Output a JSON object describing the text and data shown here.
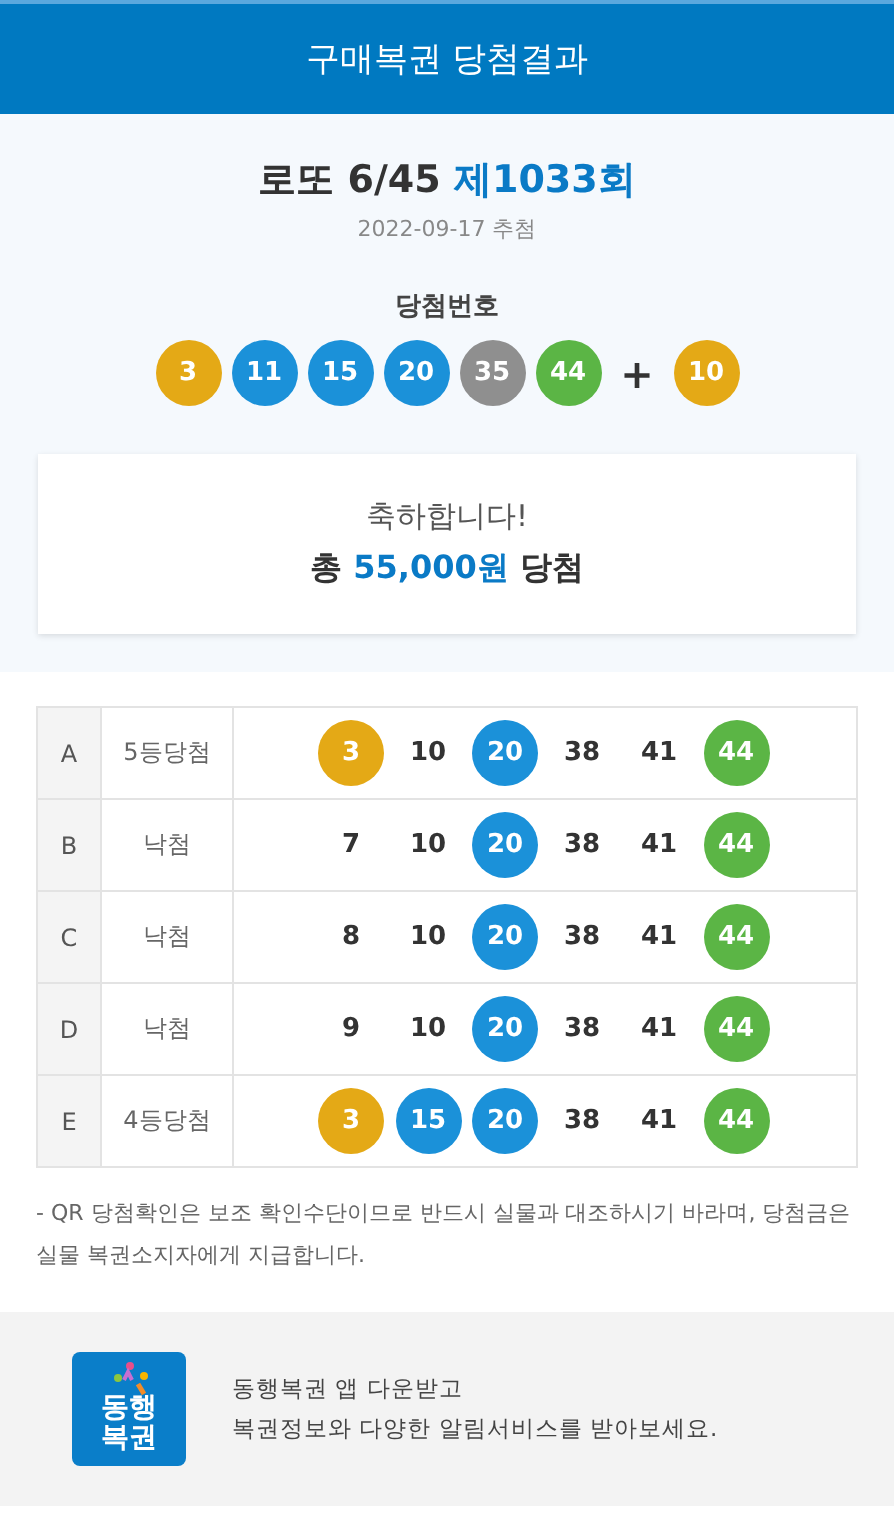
{
  "header": {
    "title": "구매복권 당첨결과"
  },
  "draw": {
    "game": "로또 6/45",
    "round": "제1033회",
    "date": "2022-09-17 추첨",
    "numbers_label": "당첨번호",
    "numbers": [
      {
        "number": "3",
        "color": "#e4a916"
      },
      {
        "number": "11",
        "color": "#1b91d9"
      },
      {
        "number": "15",
        "color": "#1b91d9"
      },
      {
        "number": "20",
        "color": "#1b91d9"
      },
      {
        "number": "35",
        "color": "#8f8f8f"
      },
      {
        "number": "44",
        "color": "#5bb545"
      }
    ],
    "plus": "+",
    "bonus": {
      "number": "10",
      "color": "#e4a916"
    }
  },
  "result": {
    "greeting": "축하합니다!",
    "prefix": "총",
    "amount": "55,000원",
    "suffix": "당첨"
  },
  "tickets": [
    {
      "game": "A",
      "result": "5등당첨",
      "numbers": [
        {
          "number": "3",
          "matched": true,
          "color": "#e4a916"
        },
        {
          "number": "10",
          "matched": false
        },
        {
          "number": "20",
          "matched": true,
          "color": "#1b91d9"
        },
        {
          "number": "38",
          "matched": false
        },
        {
          "number": "41",
          "matched": false
        },
        {
          "number": "44",
          "matched": true,
          "color": "#5bb545"
        }
      ]
    },
    {
      "game": "B",
      "result": "낙첨",
      "numbers": [
        {
          "number": "7",
          "matched": false
        },
        {
          "number": "10",
          "matched": false
        },
        {
          "number": "20",
          "matched": true,
          "color": "#1b91d9"
        },
        {
          "number": "38",
          "matched": false
        },
        {
          "number": "41",
          "matched": false
        },
        {
          "number": "44",
          "matched": true,
          "color": "#5bb545"
        }
      ]
    },
    {
      "game": "C",
      "result": "낙첨",
      "numbers": [
        {
          "number": "8",
          "matched": false
        },
        {
          "number": "10",
          "matched": false
        },
        {
          "number": "20",
          "matched": true,
          "color": "#1b91d9"
        },
        {
          "number": "38",
          "matched": false
        },
        {
          "number": "41",
          "matched": false
        },
        {
          "number": "44",
          "matched": true,
          "color": "#5bb545"
        }
      ]
    },
    {
      "game": "D",
      "result": "낙첨",
      "numbers": [
        {
          "number": "9",
          "matched": false
        },
        {
          "number": "10",
          "matched": false
        },
        {
          "number": "20",
          "matched": true,
          "color": "#1b91d9"
        },
        {
          "number": "38",
          "matched": false
        },
        {
          "number": "41",
          "matched": false
        },
        {
          "number": "44",
          "matched": true,
          "color": "#5bb545"
        }
      ]
    },
    {
      "game": "E",
      "result": "4등당첨",
      "numbers": [
        {
          "number": "3",
          "matched": true,
          "color": "#e4a916"
        },
        {
          "number": "15",
          "matched": true,
          "color": "#1b91d9"
        },
        {
          "number": "20",
          "matched": true,
          "color": "#1b91d9"
        },
        {
          "number": "38",
          "matched": false
        },
        {
          "number": "41",
          "matched": false
        },
        {
          "number": "44",
          "matched": true,
          "color": "#5bb545"
        }
      ]
    }
  ],
  "notice": "- QR 당첨확인은 보조 확인수단이므로 반드시 실물과 대조하시기 바라며, 당첨금은 실물 복권소지자에게 지급합니다.",
  "app_banner": {
    "logo_lines": [
      "동행",
      "복권"
    ],
    "lines": [
      "동행복권 앱 다운받고",
      "복권정보와 다양한 알림서비스를 받아보세요."
    ]
  }
}
